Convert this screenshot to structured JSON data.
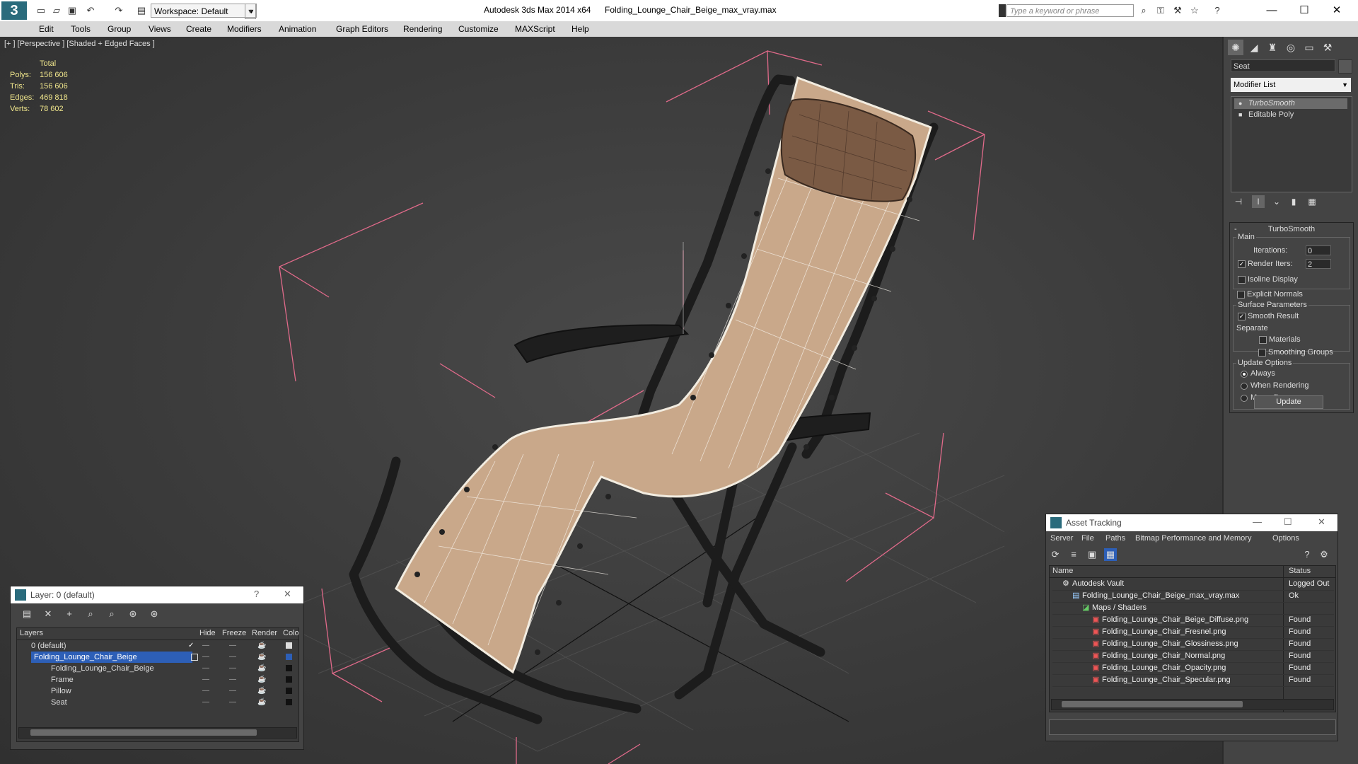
{
  "app": {
    "title": "Autodesk 3ds Max  2014 x64",
    "file": "Folding_Lounge_Chair_Beige_max_vray.max",
    "workspace": "Workspace: Default",
    "search_placeholder": "Type a keyword or phrase",
    "logo": "3"
  },
  "menu": [
    "Edit",
    "Tools",
    "Group",
    "Views",
    "Create",
    "Modifiers",
    "Animation",
    "Graph Editors",
    "Rendering",
    "Customize",
    "MAXScript",
    "Help"
  ],
  "viewport": {
    "label": "[+ ] [Perspective ] [Shaded + Edged Faces ]",
    "stats": {
      "header": "Total",
      "rows": [
        {
          "label": "Polys:",
          "value": "156 606"
        },
        {
          "label": "Tris:",
          "value": "156 606"
        },
        {
          "label": "Edges:",
          "value": "469 818"
        },
        {
          "label": "Verts:",
          "value": "78 602"
        }
      ]
    }
  },
  "command_panel": {
    "object_name": "Seat",
    "modifier_list": "Modifier List",
    "stack": [
      {
        "label": "TurboSmooth",
        "selected": true
      },
      {
        "label": "Editable Poly",
        "selected": false
      }
    ],
    "turbosmooth": {
      "title": "TurboSmooth",
      "main_label": "Main",
      "iterations_label": "Iterations:",
      "iterations_value": "0",
      "render_iters_label": "Render Iters:",
      "render_iters_value": "2",
      "isoline_label": "Isoline Display",
      "explicit_normals_label": "Explicit Normals",
      "surface_params_label": "Surface Parameters",
      "smooth_result_label": "Smooth Result",
      "separate_label": "Separate",
      "materials_label": "Materials",
      "smoothing_groups_label": "Smoothing Groups",
      "update_options_label": "Update Options",
      "always_label": "Always",
      "when_rendering_label": "When Rendering",
      "manually_label": "Manually",
      "update_button": "Update"
    }
  },
  "layer_window": {
    "title": "Layer: 0 (default)",
    "help": "?",
    "columns": [
      "Layers",
      "Hide",
      "Freeze",
      "Render",
      "Colo"
    ],
    "rows": [
      {
        "name": "0 (default)",
        "selected": false,
        "indent": 0
      },
      {
        "name": "Folding_Lounge_Chair_Beige",
        "selected": true,
        "indent": 0
      },
      {
        "name": "Folding_Lounge_Chair_Beige",
        "selected": false,
        "indent": 1
      },
      {
        "name": "Frame",
        "selected": false,
        "indent": 1
      },
      {
        "name": "Pillow",
        "selected": false,
        "indent": 1
      },
      {
        "name": "Seat",
        "selected": false,
        "indent": 1
      }
    ]
  },
  "asset_window": {
    "title": "Asset Tracking",
    "menu": [
      "Server",
      "File",
      "Paths",
      "Bitmap Performance and Memory",
      "Options"
    ],
    "columns": [
      "Name",
      "Status"
    ],
    "rows": [
      {
        "name": "Autodesk Vault",
        "status": "Logged Out",
        "indent": 0
      },
      {
        "name": "Folding_Lounge_Chair_Beige_max_vray.max",
        "status": "Ok",
        "indent": 1
      },
      {
        "name": "Maps / Shaders",
        "status": "",
        "indent": 2
      },
      {
        "name": "Folding_Lounge_Chair_Beige_Diffuse.png",
        "status": "Found",
        "indent": 3
      },
      {
        "name": "Folding_Lounge_Chair_Fresnel.png",
        "status": "Found",
        "indent": 3
      },
      {
        "name": "Folding_Lounge_Chair_Glossiness.png",
        "status": "Found",
        "indent": 3
      },
      {
        "name": "Folding_Lounge_Chair_Normal.png",
        "status": "Found",
        "indent": 3
      },
      {
        "name": "Folding_Lounge_Chair_Opacity.png",
        "status": "Found",
        "indent": 3
      },
      {
        "name": "Folding_Lounge_Chair_Specular.png",
        "status": "Found",
        "indent": 3
      }
    ]
  },
  "colors": {
    "stats": "#f0e68c",
    "selection": "#2d5fb7",
    "bbox": "#e06a8a",
    "seat": "#c9a88a",
    "frame": "#1c1c1c"
  }
}
